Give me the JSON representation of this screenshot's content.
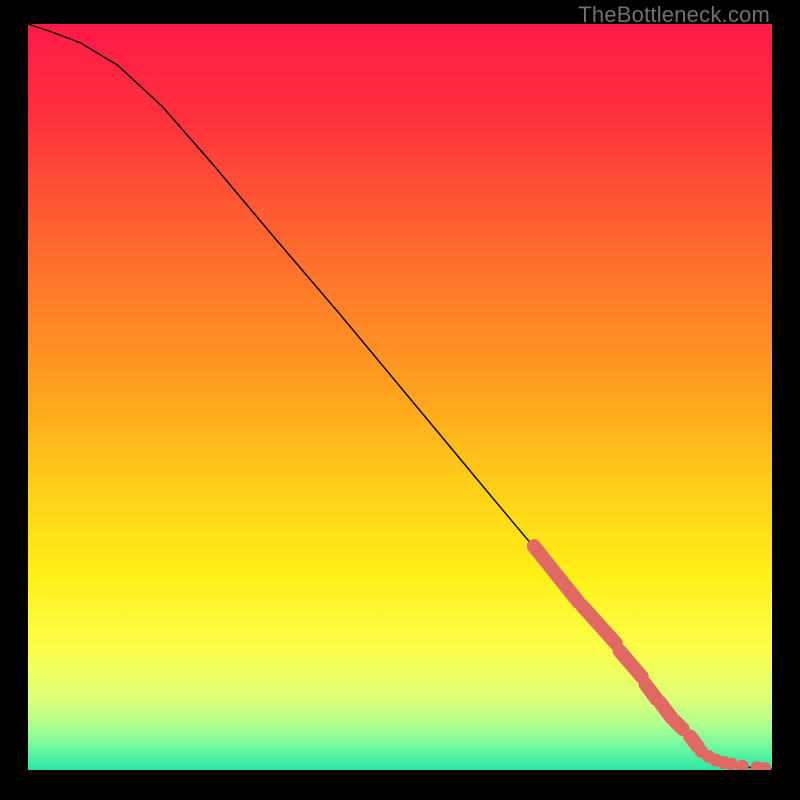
{
  "watermark": "TheBottleneck.com",
  "chart_data": {
    "type": "line",
    "title": "",
    "xlabel": "",
    "ylabel": "",
    "xlim": [
      0,
      100
    ],
    "ylim": [
      0,
      100
    ],
    "curve": {
      "name": "bottleneck-curve",
      "x": [
        0,
        3,
        7,
        12,
        18,
        25,
        33,
        42,
        52,
        62,
        70,
        77,
        82,
        85,
        88,
        90,
        92,
        95,
        98,
        100
      ],
      "y": [
        100,
        99,
        97.5,
        94.5,
        89,
        81,
        71.5,
        61,
        49,
        37,
        27.5,
        18.5,
        13,
        9,
        5.5,
        3,
        1.5,
        0.6,
        0.2,
        0.1
      ]
    },
    "highlight_segments": [
      {
        "x": [
          68,
          74
        ],
        "y": [
          30,
          22.5
        ]
      },
      {
        "x": [
          74.5,
          79
        ],
        "y": [
          22,
          17
        ]
      },
      {
        "x": [
          79.5,
          82.5
        ],
        "y": [
          16,
          12.5
        ]
      },
      {
        "x": [
          83,
          84.5
        ],
        "y": [
          11.5,
          9.5
        ]
      },
      {
        "x": [
          85,
          86.5
        ],
        "y": [
          9,
          7
        ]
      },
      {
        "x": [
          87,
          88
        ],
        "y": [
          6.5,
          5.5
        ]
      },
      {
        "x": [
          89,
          90
        ],
        "y": [
          4.5,
          3.2
        ]
      }
    ],
    "highlight_points_flat": [
      {
        "x": 90.5,
        "y": 2.5
      },
      {
        "x": 91.5,
        "y": 1.8
      },
      {
        "x": 92.5,
        "y": 1.3
      },
      {
        "x": 93.5,
        "y": 1.0
      },
      {
        "x": 94.5,
        "y": 0.8
      },
      {
        "x": 96.0,
        "y": 0.5
      },
      {
        "x": 98.0,
        "y": 0.3
      },
      {
        "x": 99.0,
        "y": 0.2
      }
    ],
    "gradient_stops": [
      {
        "offset": 0.0,
        "color": "#ff1a47"
      },
      {
        "offset": 0.12,
        "color": "#ff2f3e"
      },
      {
        "offset": 0.25,
        "color": "#ff5a32"
      },
      {
        "offset": 0.38,
        "color": "#ff8128"
      },
      {
        "offset": 0.5,
        "color": "#ffa41e"
      },
      {
        "offset": 0.62,
        "color": "#ffcf18"
      },
      {
        "offset": 0.74,
        "color": "#fff019"
      },
      {
        "offset": 0.84,
        "color": "#fcff4a"
      },
      {
        "offset": 0.9,
        "color": "#e0ff75"
      },
      {
        "offset": 0.94,
        "color": "#b0ff90"
      },
      {
        "offset": 0.97,
        "color": "#6cf7a0"
      },
      {
        "offset": 1.0,
        "color": "#2ae6a2"
      }
    ],
    "colors": {
      "curve": "#000000",
      "marker_fill": "#e06a63",
      "marker_stroke": "#e06a63",
      "background": "#000000"
    }
  }
}
